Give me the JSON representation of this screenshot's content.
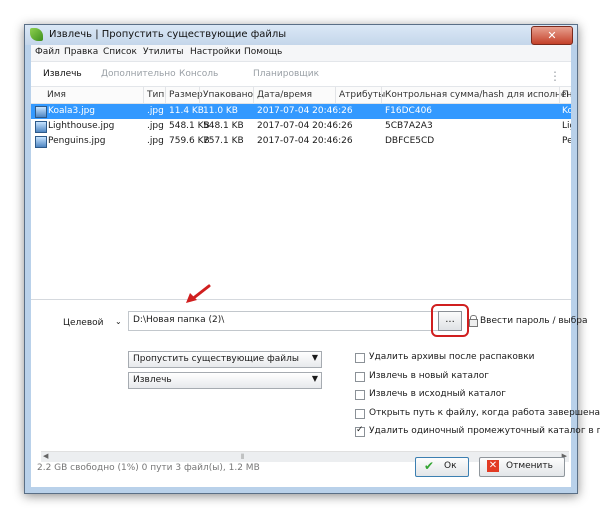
{
  "window": {
    "title": "Извлечь | Пропустить существующие файлы",
    "close_glyph": "✕"
  },
  "menu": [
    "Файл",
    "Правка",
    "Список",
    "Утилиты",
    "Настройки",
    "Помощь"
  ],
  "toolbar": {
    "items": [
      "Извлечь",
      "Дополнительно",
      "Консоль",
      "Планировщик"
    ],
    "more_glyph": "⋮"
  },
  "table": {
    "columns": [
      "Имя",
      "Тип",
      "Размер",
      "Упаковано",
      "Дата/время",
      "Атрибуты",
      "Контрольная сумма/hash для исполнения",
      "П"
    ],
    "rows": [
      {
        "name": "Koala3.jpg",
        "type": ".jpg",
        "size": "11.4 KB",
        "packed": "11.0 KB",
        "datetime": "2017-07-04 20:46:26",
        "attrs": "",
        "hash": "F16DC406",
        "extra": "Ko"
      },
      {
        "name": "Lighthouse.jpg",
        "type": ".jpg",
        "size": "548.1 KB",
        "packed": "548.1 KB",
        "datetime": "2017-07-04 20:46:26",
        "attrs": "",
        "hash": "5CB7A2A3",
        "extra": "Lig"
      },
      {
        "name": "Penguins.jpg",
        "type": ".jpg",
        "size": "759.6 KB",
        "packed": "757.1 KB",
        "datetime": "2017-07-04 20:46:26",
        "attrs": "",
        "hash": "DBFCE5CD",
        "extra": "Pe"
      }
    ]
  },
  "destination": {
    "label": "Целевой",
    "path": "D:\\Новая папка (2)\\",
    "browse_label": "...",
    "password_label": "Ввести пароль / выбра"
  },
  "selects": {
    "overwrite": "Пропустить существующие файлы",
    "mode": "Извлечь"
  },
  "options": [
    {
      "label": "Удалить архивы после распаковки",
      "checked": false
    },
    {
      "label": "Извлечь в новый каталог",
      "checked": false
    },
    {
      "label": "Извлечь в исходный каталог",
      "checked": false
    },
    {
      "label": "Открыть путь к файлу, когда работа завершена",
      "checked": false
    },
    {
      "label": "Удалить одиночный промежуточный каталог в пр",
      "checked": true
    }
  ],
  "status": "2.2 GB свободно (1%)   0 пути 3 файл(ы), 1.2 MB",
  "buttons": {
    "ok": "Ок",
    "cancel": "Отменить"
  },
  "colors": {
    "selection": "#3399ff",
    "highlight": "#d01f1f",
    "ok_check": "#33a532",
    "cancel_x": "#e23b24"
  }
}
